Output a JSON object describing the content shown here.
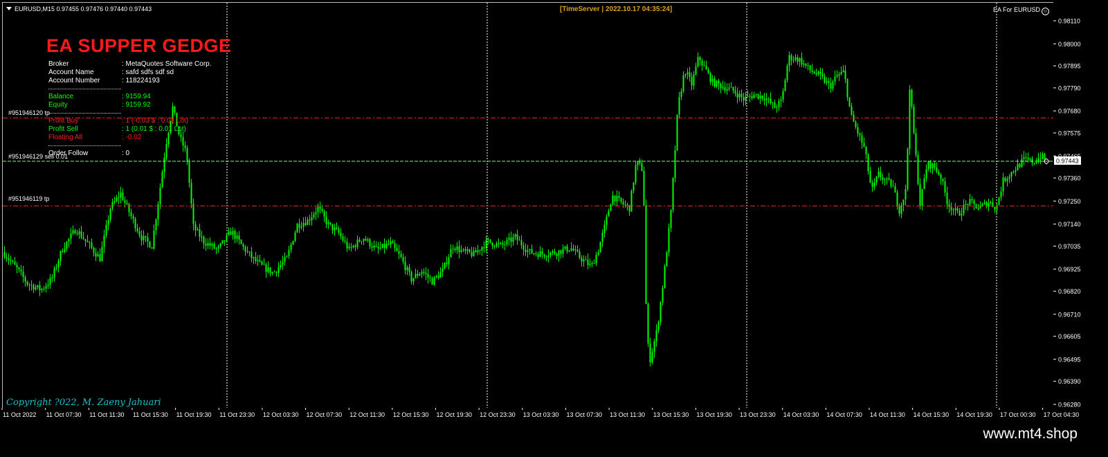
{
  "header": {
    "symbol_info": "EURUSD,M15  0.97455 0.97476 0.97440 0.97443",
    "timeserver": "[TimeServer | 2022.10.17 04:35:24]",
    "ea_label": "EA For EURUSD"
  },
  "ea_panel": {
    "title": "EA SUPPER GEDGE",
    "broker": {
      "label": "Broker",
      "value": ": MetaQuotes Software Corp."
    },
    "account_name": {
      "label": "Account Name",
      "value": ": safd    sdfs sdf  sd"
    },
    "account_number": {
      "label": "Account Number",
      "value": ": 118224193"
    },
    "balance": {
      "label": "Balance",
      "value": ": 9159.94"
    },
    "equity": {
      "label": "Equity",
      "value": ": 9159.92"
    },
    "profit_buy": {
      "label": "Profit Buy",
      "value": ": 1 (-0.03 $ : 0.01 Lot)"
    },
    "profit_sell": {
      "label": "Profit Sell",
      "value": ": 1 (0.01 $ : 0.01 Lot)"
    },
    "floating_all": {
      "label": "Floating All",
      "value": ": -0.02"
    },
    "order_follow": {
      "label": "Order Follow",
      "value": ": 0"
    }
  },
  "level_labels": {
    "tp_upper": "#951946120 tp",
    "sell_line": "#951946129 sell 0.01",
    "tp_lower": "#951946119 tp"
  },
  "current_price": "0.97443",
  "copyright": "Copyright ?022, M. Zaeny Jahuari",
  "watermark": "www.mt4.shop",
  "price_axis": {
    "labels": [
      "0.98110",
      "0.98000",
      "0.97895",
      "0.97790",
      "0.97680",
      "0.97575",
      "0.97465",
      "0.97360",
      "0.97250",
      "0.97140",
      "0.97035",
      "0.96925",
      "0.96820",
      "0.96710",
      "0.96605",
      "0.96495",
      "0.96390",
      "0.96280"
    ],
    "min": 0.9628,
    "max": 0.9811
  },
  "time_axis": {
    "labels": [
      "11 Oct 2022",
      "11 Oct 07:30",
      "11 Oct 11:30",
      "11 Oct 15:30",
      "11 Oct 19:30",
      "11 Oct 23:30",
      "12 Oct 03:30",
      "12 Oct 07:30",
      "12 Oct 11:30",
      "12 Oct 15:30",
      "12 Oct 19:30",
      "12 Oct 23:30",
      "13 Oct 03:30",
      "13 Oct 07:30",
      "13 Oct 11:30",
      "13 Oct 15:30",
      "13 Oct 19:30",
      "13 Oct 23:30",
      "14 Oct 03:30",
      "14 Oct 07:30",
      "14 Oct 11:30",
      "14 Oct 15:30",
      "14 Oct 19:30",
      "17 Oct 00:30",
      "17 Oct 04:30"
    ]
  },
  "colors": {
    "candles": "#00ff00",
    "tp_line": "#ff2020",
    "sell_line": "#7dff7d",
    "grid": "#ffffff",
    "ea_title": "#ff1a1a",
    "info_white": "#ffffff",
    "info_green": "#00ff00",
    "info_red": "#ff2020",
    "timeserver": "#d9a020",
    "copyright": "#19c0d0"
  },
  "chart_data": {
    "type": "candlestick",
    "symbol": "EURUSD",
    "timeframe": "M15",
    "ohlc_last": {
      "open": 0.97455,
      "high": 0.97476,
      "low": 0.9744,
      "close": 0.97443
    },
    "price_lines": {
      "tp_upper": 0.9765,
      "sell_entry": 0.97443,
      "tp_lower": 0.9723
    },
    "path_keypoints": [
      [
        0,
        0.9701
      ],
      [
        20,
        0.9693
      ],
      [
        35,
        0.9686
      ],
      [
        55,
        0.9683
      ],
      [
        70,
        0.9688
      ],
      [
        85,
        0.9702
      ],
      [
        105,
        0.9712
      ],
      [
        125,
        0.9704
      ],
      [
        140,
        0.9698
      ],
      [
        155,
        0.9722
      ],
      [
        170,
        0.9729
      ],
      [
        185,
        0.9718
      ],
      [
        200,
        0.9708
      ],
      [
        215,
        0.9704
      ],
      [
        225,
        0.9727
      ],
      [
        235,
        0.9752
      ],
      [
        245,
        0.977
      ],
      [
        255,
        0.9756
      ],
      [
        265,
        0.9748
      ],
      [
        275,
        0.9713
      ],
      [
        290,
        0.9706
      ],
      [
        310,
        0.9702
      ],
      [
        330,
        0.9711
      ],
      [
        345,
        0.9704
      ],
      [
        360,
        0.9698
      ],
      [
        375,
        0.9694
      ],
      [
        390,
        0.9691
      ],
      [
        410,
        0.9698
      ],
      [
        425,
        0.9714
      ],
      [
        440,
        0.9716
      ],
      [
        455,
        0.9722
      ],
      [
        470,
        0.9714
      ],
      [
        485,
        0.971
      ],
      [
        500,
        0.9702
      ],
      [
        520,
        0.9708
      ],
      [
        540,
        0.9702
      ],
      [
        560,
        0.9705
      ],
      [
        575,
        0.9698
      ],
      [
        590,
        0.9688
      ],
      [
        605,
        0.9692
      ],
      [
        620,
        0.9687
      ],
      [
        635,
        0.9692
      ],
      [
        650,
        0.9704
      ],
      [
        665,
        0.9701
      ],
      [
        680,
        0.97
      ],
      [
        700,
        0.9706
      ],
      [
        720,
        0.9704
      ],
      [
        740,
        0.9708
      ],
      [
        760,
        0.9701
      ],
      [
        780,
        0.97
      ],
      [
        800,
        0.9701
      ],
      [
        820,
        0.9703
      ],
      [
        835,
        0.9698
      ],
      [
        850,
        0.9694
      ],
      [
        860,
        0.9702
      ],
      [
        870,
        0.9714
      ],
      [
        880,
        0.9728
      ],
      [
        895,
        0.9724
      ],
      [
        905,
        0.9722
      ],
      [
        915,
        0.9744
      ],
      [
        925,
        0.974
      ],
      [
        930,
        0.966
      ],
      [
        935,
        0.965
      ],
      [
        945,
        0.9664
      ],
      [
        955,
        0.969
      ],
      [
        965,
        0.972
      ],
      [
        975,
        0.977
      ],
      [
        985,
        0.9788
      ],
      [
        995,
        0.9781
      ],
      [
        1005,
        0.9794
      ],
      [
        1015,
        0.9788
      ],
      [
        1025,
        0.9782
      ],
      [
        1040,
        0.978
      ],
      [
        1055,
        0.9778
      ],
      [
        1070,
        0.9774
      ],
      [
        1085,
        0.9776
      ],
      [
        1100,
        0.9775
      ],
      [
        1115,
        0.977
      ],
      [
        1125,
        0.9773
      ],
      [
        1135,
        0.9794
      ],
      [
        1150,
        0.9793
      ],
      [
        1165,
        0.9788
      ],
      [
        1180,
        0.9785
      ],
      [
        1195,
        0.978
      ],
      [
        1205,
        0.9785
      ],
      [
        1215,
        0.9787
      ],
      [
        1225,
        0.9766
      ],
      [
        1235,
        0.9758
      ],
      [
        1245,
        0.975
      ],
      [
        1255,
        0.973
      ],
      [
        1265,
        0.9738
      ],
      [
        1275,
        0.9735
      ],
      [
        1285,
        0.9733
      ],
      [
        1295,
        0.9721
      ],
      [
        1305,
        0.9731
      ],
      [
        1310,
        0.978
      ],
      [
        1318,
        0.975
      ],
      [
        1325,
        0.9724
      ],
      [
        1335,
        0.9743
      ],
      [
        1345,
        0.9742
      ],
      [
        1355,
        0.9737
      ],
      [
        1365,
        0.9724
      ],
      [
        1380,
        0.9719
      ],
      [
        1395,
        0.9725
      ],
      [
        1410,
        0.9722
      ],
      [
        1425,
        0.9725
      ],
      [
        1435,
        0.9722
      ],
      [
        1445,
        0.9735
      ],
      [
        1460,
        0.974
      ],
      [
        1475,
        0.9745
      ],
      [
        1490,
        0.9744
      ],
      [
        1500,
        0.9747
      ],
      [
        1507,
        0.97443
      ]
    ]
  }
}
